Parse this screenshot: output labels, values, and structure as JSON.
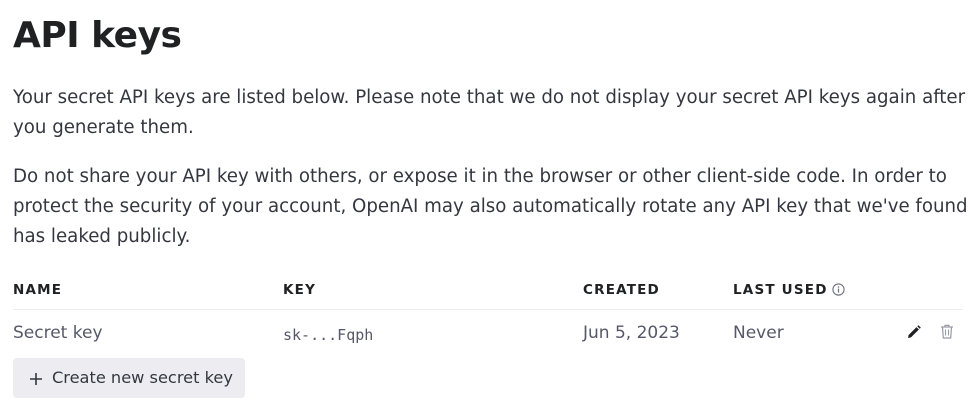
{
  "page": {
    "title": "API keys",
    "intro": "Your secret API keys are listed below. Please note that we do not display your secret API keys again after you generate them.",
    "warning": "Do not share your API key with others, or expose it in the browser or other client-side code. In order to protect the security of your account, OpenAI may also automatically rotate any API key that we've found has leaked publicly."
  },
  "table": {
    "headers": {
      "name": "NAME",
      "key": "KEY",
      "created": "CREATED",
      "last_used": "LAST USED"
    },
    "rows": [
      {
        "name": "Secret key",
        "key": "sk-...Fqph",
        "created": "Jun 5, 2023",
        "last_used": "Never"
      }
    ]
  },
  "actions": {
    "create_label": "Create new secret key"
  },
  "icons": {
    "info": "info-circle-icon",
    "edit": "pencil-icon",
    "delete": "trash-icon",
    "add": "plus-icon"
  },
  "colors": {
    "text_primary": "#202123",
    "text_secondary": "#565869",
    "button_bg": "#ececf1",
    "divider": "#ececf1"
  }
}
